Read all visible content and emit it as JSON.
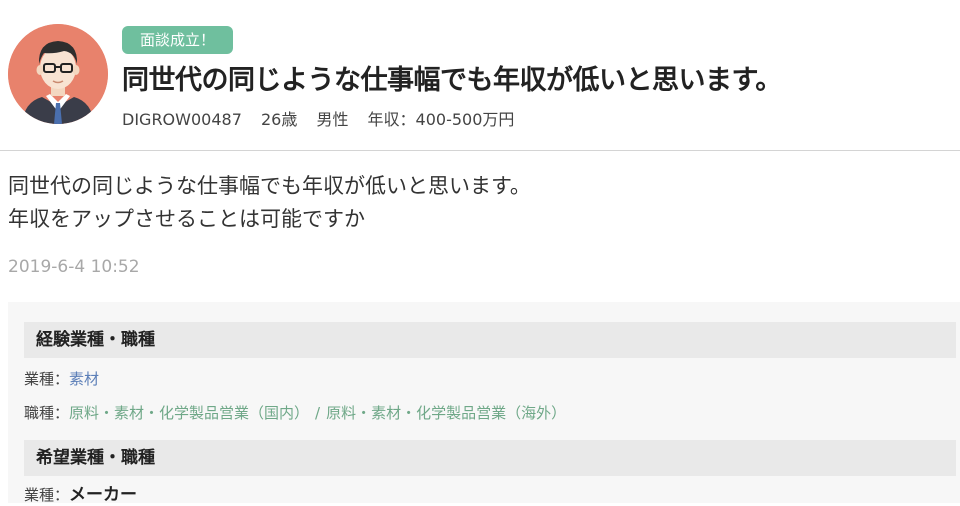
{
  "badge": "面談成立！",
  "title": "同世代の同じような仕事幅でも年収が低いと思います。",
  "meta": {
    "id": "DIGROW00487",
    "age": "26歳",
    "gender": "男性",
    "income": "年収：400-500万円"
  },
  "body_lines": [
    "同世代の同じような仕事幅でも年収が低いと思います。",
    "年収をアップさせることは可能ですか"
  ],
  "timestamp": "2019-6-4 10:52",
  "experience": {
    "heading": "経験業種・職種",
    "industry_label": "業種：",
    "industry_value": "素材",
    "job_label": "職種：",
    "job_values": [
      "原料・素材・化学製品営業（国内）",
      "原料・素材・化学製品営業（海外）"
    ],
    "job_separator": "/"
  },
  "desired": {
    "heading": "希望業種・職種",
    "industry_label": "業種：",
    "industry_value": "メーカー"
  },
  "colors": {
    "avatar_bg": "#e8826c",
    "badge_bg": "#6fbf9e",
    "link_green": "#6fa888"
  },
  "icons": {
    "avatar": "man-with-glasses-avatar-icon"
  }
}
